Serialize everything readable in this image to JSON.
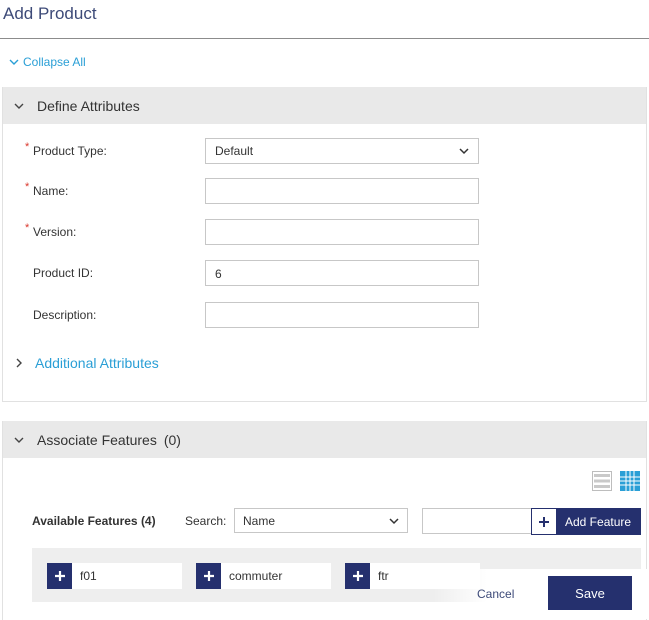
{
  "page": {
    "title": "Add Product"
  },
  "collapse_all": {
    "label": "Collapse All"
  },
  "define_attributes": {
    "title": "Define Attributes",
    "fields": {
      "product_type": {
        "label": "Product Type:",
        "required": "*",
        "value": "Default"
      },
      "name": {
        "label": "Name:",
        "required": "*",
        "value": ""
      },
      "version": {
        "label": "Version:",
        "required": "*",
        "value": ""
      },
      "product_id": {
        "label": "Product ID:",
        "value": "6"
      },
      "description": {
        "label": "Description:",
        "value": ""
      }
    },
    "additional_attributes": "Additional Attributes"
  },
  "associate_features": {
    "title": "Associate Features",
    "count": "(0)",
    "available_label": "Available Features (4)",
    "search_label": "Search:",
    "search_by": "Name",
    "search_value": "",
    "add_feature_label": "Add Feature",
    "features": [
      "f01",
      "commuter",
      "ftr"
    ]
  },
  "actions": {
    "cancel": "Cancel",
    "save": "Save"
  },
  "colors": {
    "accent": "#25306e",
    "link": "#2a9fd6",
    "required": "#d9362b",
    "header_bg": "#e9e9e9",
    "grid_view": "#2a9fd6"
  },
  "icons": {
    "collapse": "chevron-down-icon",
    "expand": "chevron-right-icon",
    "add": "plus-icon",
    "list_view": "list-view-icon",
    "grid_view": "grid-view-icon"
  }
}
